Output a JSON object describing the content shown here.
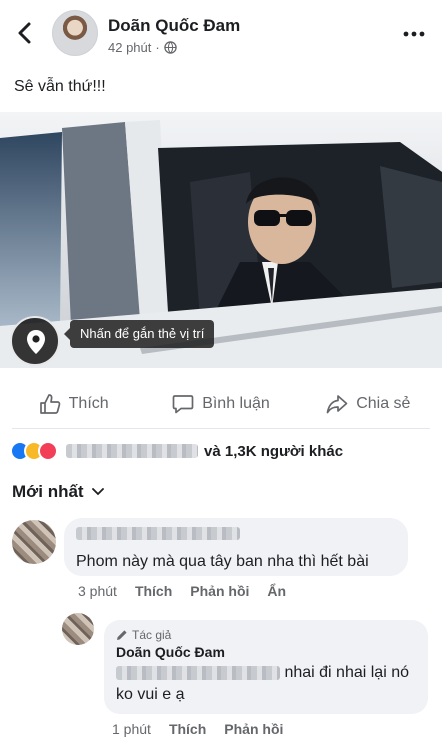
{
  "header": {
    "author": "Doãn Quốc Đam",
    "time": "42 phút"
  },
  "post": {
    "caption": "Sê vẫn thứ!!!"
  },
  "photo_overlay": {
    "tag_tip": "Nhấn để gắn thẻ vị trí"
  },
  "actions": {
    "like": "Thích",
    "comment": "Bình luận",
    "share": "Chia sẻ"
  },
  "reactions": {
    "summary": "và 1,3K người khác"
  },
  "comments_sort": "Mới nhất",
  "comments": [
    {
      "text": "Phom này mà qua tây ban nha thì hết bài",
      "time": "3 phút",
      "like": "Thích",
      "reply": "Phản hồi",
      "hide": "Ẩn"
    }
  ],
  "reply": {
    "badge": "Tác giả",
    "name": "Doãn Quốc Đam",
    "text_line1": "nhai đi nhai lại nó",
    "text_line2": "ko vui e ạ",
    "time": "1 phút",
    "like": "Thích",
    "reply": "Phản hồi"
  },
  "colors": {
    "link_blue": "#1877f2",
    "text_secondary": "#65676b",
    "bubble_bg": "#f0f2f5"
  }
}
